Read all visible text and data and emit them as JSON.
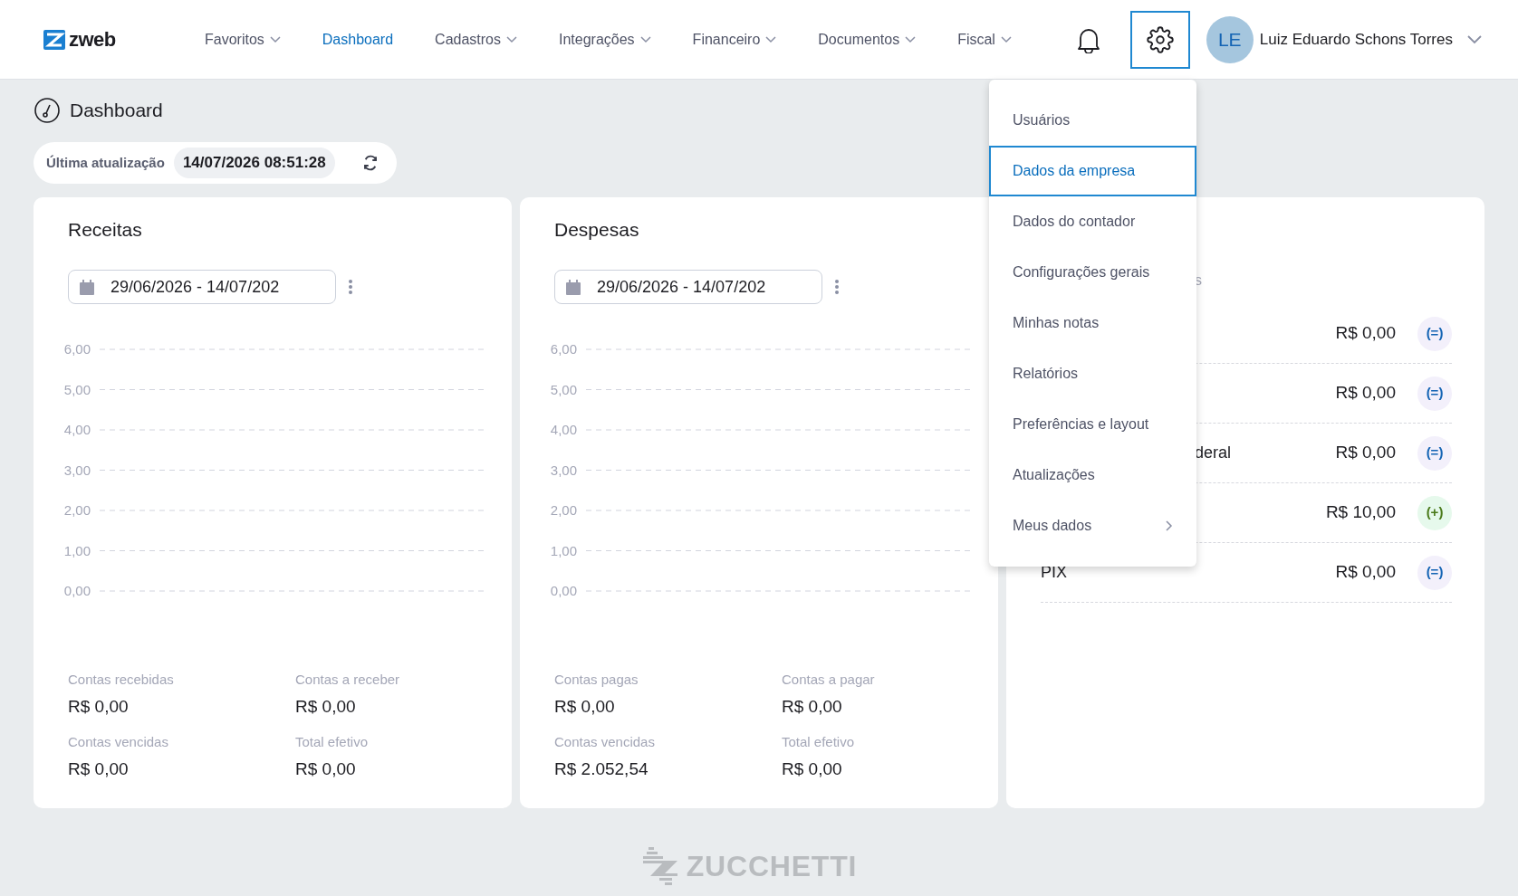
{
  "header": {
    "brand": "zweb",
    "nav": [
      {
        "label": "Favoritos",
        "dropdown": true,
        "selected": false
      },
      {
        "label": "Dashboard",
        "dropdown": false,
        "selected": true
      },
      {
        "label": "Cadastros",
        "dropdown": true,
        "selected": false
      },
      {
        "label": "Integrações",
        "dropdown": true,
        "selected": false
      },
      {
        "label": "Financeiro",
        "dropdown": true,
        "selected": false
      },
      {
        "label": "Documentos",
        "dropdown": true,
        "selected": false
      },
      {
        "label": "Fiscal",
        "dropdown": true,
        "selected": false
      }
    ],
    "settings_active": true,
    "user": {
      "initials": "LE",
      "name": "Luiz Eduardo Schons Torres"
    }
  },
  "page": {
    "title": "Dashboard",
    "last_update": {
      "label": "Última atualização",
      "value": "14/07/2026 08:51:28"
    }
  },
  "cards": [
    {
      "title": "Receitas",
      "date_range": "29/06/2026 - 14/07/202",
      "axis_labels": [
        "6,00",
        "5,00",
        "4,00",
        "3,00",
        "2,00",
        "1,00",
        "0,00"
      ],
      "stats": [
        {
          "label": "Contas recebidas",
          "value": "R$ 0,00"
        },
        {
          "label": "Contas a receber",
          "value": "R$ 0,00"
        },
        {
          "label": "Contas vencidas",
          "value": "R$ 0,00"
        },
        {
          "label": "Total efetivo",
          "value": "R$ 0,00"
        }
      ]
    },
    {
      "title": "Despesas",
      "date_range": "29/06/2026 - 14/07/202",
      "axis_labels": [
        "6,00",
        "5,00",
        "4,00",
        "3,00",
        "2,00",
        "1,00",
        "0,00"
      ],
      "stats": [
        {
          "label": "Contas pagas",
          "value": "R$ 0,00"
        },
        {
          "label": "Contas a pagar",
          "value": "R$ 0,00"
        },
        {
          "label": "Contas vencidas",
          "value": "R$ 2.052,54"
        },
        {
          "label": "Total efetivo",
          "value": "R$ 0,00"
        }
      ]
    }
  ],
  "summary_card": {
    "subtitle": "s",
    "rows": [
      {
        "value": "R$ 0,00",
        "badge": "(=)",
        "kind": "neutral"
      },
      {
        "value": "R$ 0,00",
        "badge": "(=)",
        "kind": "neutral"
      },
      {
        "label": "deral",
        "label_cut": true,
        "value": "R$ 0,00",
        "badge": "(=)",
        "kind": "neutral"
      },
      {
        "value": "R$ 10,00",
        "badge": "(+)",
        "kind": "positive"
      },
      {
        "label": "PIX",
        "label_cut": false,
        "value": "R$ 0,00",
        "badge": "(=)",
        "kind": "neutral"
      }
    ]
  },
  "settings_menu": {
    "items": [
      {
        "label": "Usuários",
        "selected": false,
        "submenu": false
      },
      {
        "label": "Dados da empresa",
        "selected": true,
        "submenu": false
      },
      {
        "label": "Dados do contador",
        "selected": false,
        "submenu": false
      },
      {
        "label": "Configurações gerais",
        "selected": false,
        "submenu": false
      },
      {
        "label": "Minhas notas",
        "selected": false,
        "submenu": false
      },
      {
        "label": "Relatórios",
        "selected": false,
        "submenu": false
      },
      {
        "label": "Preferências e layout",
        "selected": false,
        "submenu": false
      },
      {
        "label": "Atualizações",
        "selected": false,
        "submenu": false
      },
      {
        "label": "Meus dados",
        "selected": false,
        "submenu": true
      }
    ]
  },
  "footer": {
    "brand": "ZUCCHETTI"
  }
}
